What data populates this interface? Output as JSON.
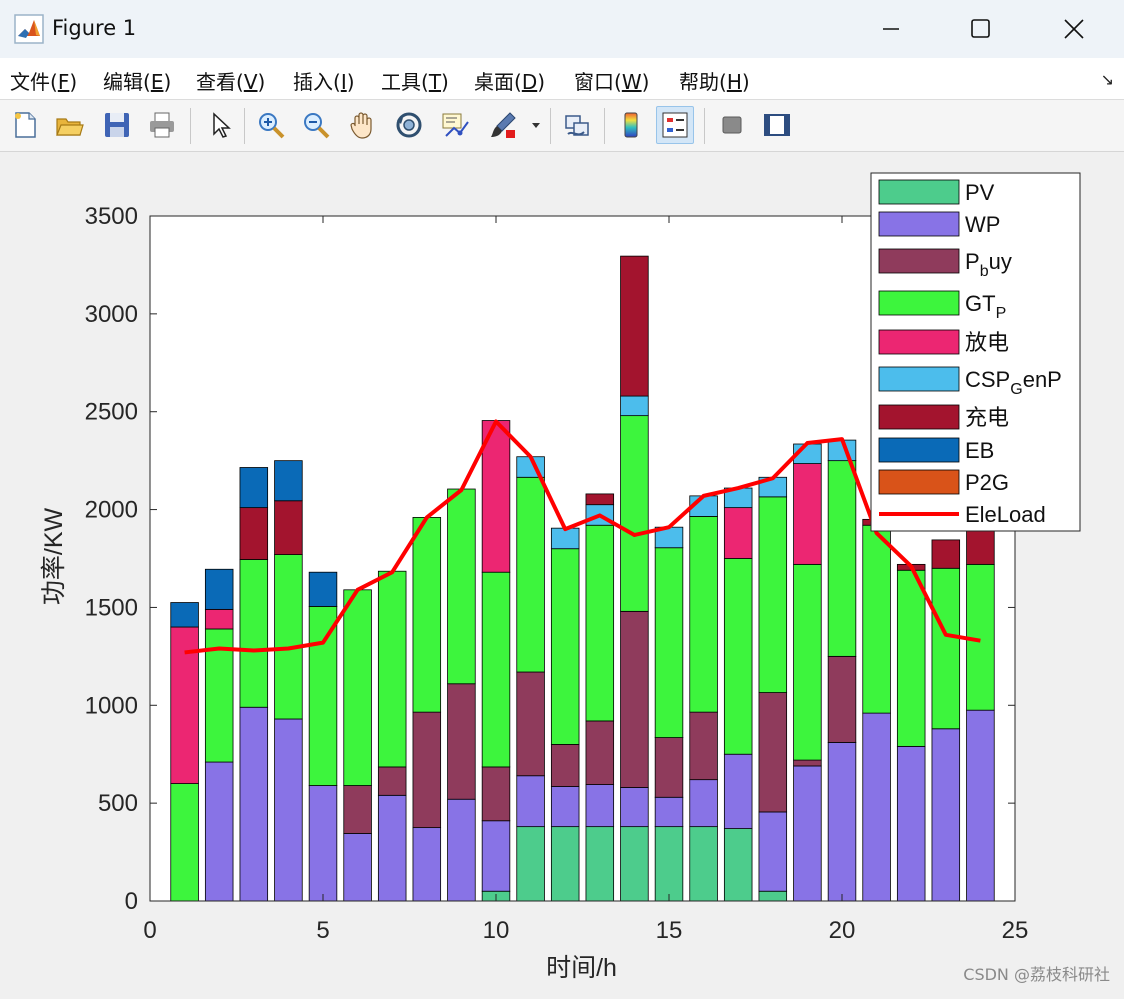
{
  "window": {
    "title": "Figure 1",
    "menu": [
      {
        "label": "文件(",
        "key": "F",
        "suffix": ")"
      },
      {
        "label": "编辑(",
        "key": "E",
        "suffix": ")"
      },
      {
        "label": "查看(",
        "key": "V",
        "suffix": ")"
      },
      {
        "label": "插入(",
        "key": "I",
        "suffix": ")"
      },
      {
        "label": "工具(",
        "key": "T",
        "suffix": ")"
      },
      {
        "label": "桌面(",
        "key": "D",
        "suffix": ")"
      },
      {
        "label": "窗口(",
        "key": "W",
        "suffix": ")"
      },
      {
        "label": "帮助(",
        "key": "H",
        "suffix": ")"
      }
    ],
    "toolbar": [
      "new-file-icon",
      "open-folder-icon",
      "save-icon",
      "print-icon",
      "pointer-icon",
      "zoom-in-icon",
      "zoom-out-icon",
      "pan-hand-icon",
      "rotate-3d-icon",
      "data-cursor-icon",
      "brush-icon",
      "link-plot-icon",
      "colorbar-icon",
      "legend-icon",
      "hide-plot-tools-icon",
      "show-plot-tools-icon"
    ]
  },
  "watermark": "CSDN @荔枝科研社",
  "chart_data": {
    "type": "bar",
    "stacked": true,
    "xlabel": "时间/h",
    "ylabel": "功率/KW",
    "xlim": [
      0,
      25
    ],
    "ylim": [
      0,
      3500
    ],
    "xticks": [
      0,
      5,
      10,
      15,
      20,
      25
    ],
    "yticks": [
      0,
      500,
      1000,
      1500,
      2000,
      2500,
      3000,
      3500
    ],
    "legend_position": "top-right",
    "x": [
      1,
      2,
      3,
      4,
      5,
      6,
      7,
      8,
      9,
      10,
      11,
      12,
      13,
      14,
      15,
      16,
      17,
      18,
      19,
      20,
      21,
      22,
      23,
      24
    ],
    "series": [
      {
        "name": "PV",
        "color": "#4dcc8c",
        "values": [
          0,
          0,
          0,
          0,
          0,
          0,
          0,
          0,
          0,
          50,
          380,
          380,
          380,
          380,
          380,
          380,
          370,
          50,
          0,
          0,
          0,
          0,
          0,
          0
        ]
      },
      {
        "name": "WP",
        "color": "#8873e6",
        "values": [
          0,
          710,
          990,
          930,
          590,
          345,
          540,
          375,
          520,
          360,
          260,
          205,
          215,
          200,
          150,
          240,
          380,
          405,
          690,
          810,
          960,
          790,
          880,
          975
        ]
      },
      {
        "name": "P_buy",
        "color": "#8f3b5c",
        "values": [
          0,
          0,
          0,
          0,
          0,
          245,
          145,
          590,
          590,
          275,
          530,
          215,
          325,
          900,
          305,
          345,
          0,
          610,
          30,
          440,
          0,
          0,
          0,
          0
        ]
      },
      {
        "name": "GT_P",
        "color": "#3df53d",
        "values": [
          600,
          680,
          755,
          840,
          915,
          1000,
          1000,
          995,
          995,
          995,
          995,
          1000,
          1000,
          1000,
          970,
          1000,
          1000,
          1000,
          1000,
          1000,
          960,
          900,
          820,
          745
        ]
      },
      {
        "name": "放电",
        "color": "#ec2672",
        "values": [
          800,
          100,
          0,
          0,
          0,
          0,
          0,
          0,
          0,
          775,
          0,
          0,
          0,
          0,
          0,
          0,
          260,
          0,
          515,
          0,
          0,
          0,
          0,
          0
        ]
      },
      {
        "name": "CSP_GenP",
        "color": "#4cbdec",
        "values": [
          0,
          0,
          0,
          0,
          0,
          0,
          0,
          0,
          0,
          0,
          105,
          105,
          105,
          100,
          105,
          105,
          100,
          100,
          100,
          105,
          0,
          0,
          0,
          0
        ]
      },
      {
        "name": "充电",
        "color": "#a3142e",
        "values": [
          0,
          0,
          265,
          275,
          0,
          0,
          0,
          0,
          0,
          0,
          0,
          0,
          55,
          715,
          0,
          0,
          0,
          0,
          0,
          0,
          30,
          30,
          145,
          190
        ]
      },
      {
        "name": "EB",
        "color": "#0a6ab7",
        "values": [
          125,
          205,
          205,
          205,
          175,
          0,
          0,
          0,
          0,
          0,
          0,
          0,
          0,
          0,
          0,
          0,
          0,
          0,
          0,
          0,
          0,
          0,
          0,
          0
        ]
      },
      {
        "name": "P2G",
        "color": "#d95319",
        "values": [
          0,
          0,
          0,
          0,
          0,
          0,
          0,
          0,
          0,
          0,
          0,
          0,
          0,
          0,
          0,
          0,
          0,
          0,
          0,
          0,
          0,
          0,
          0,
          0
        ]
      }
    ],
    "line": {
      "name": "EleLoad",
      "color": "#ff0000",
      "values": [
        1270,
        1290,
        1280,
        1290,
        1320,
        1590,
        1680,
        1960,
        2100,
        2450,
        2270,
        1900,
        1970,
        1870,
        1910,
        2070,
        2110,
        2160,
        2340,
        2360,
        1880,
        1710,
        1360,
        1330
      ]
    },
    "legend_labels": {
      "PV": "PV",
      "WP": "WP",
      "P_buy": {
        "main": "P",
        "sub": "b",
        "rest": "uy"
      },
      "GT_P": {
        "main": "GT",
        "sub": "P",
        "rest": ""
      },
      "放电": "放电",
      "CSP_GenP": {
        "main": "CSP",
        "sub": "G",
        "rest": "enP"
      },
      "充电": "充电",
      "EB": "EB",
      "P2G": "P2G",
      "EleLoad": "EleLoad"
    }
  }
}
